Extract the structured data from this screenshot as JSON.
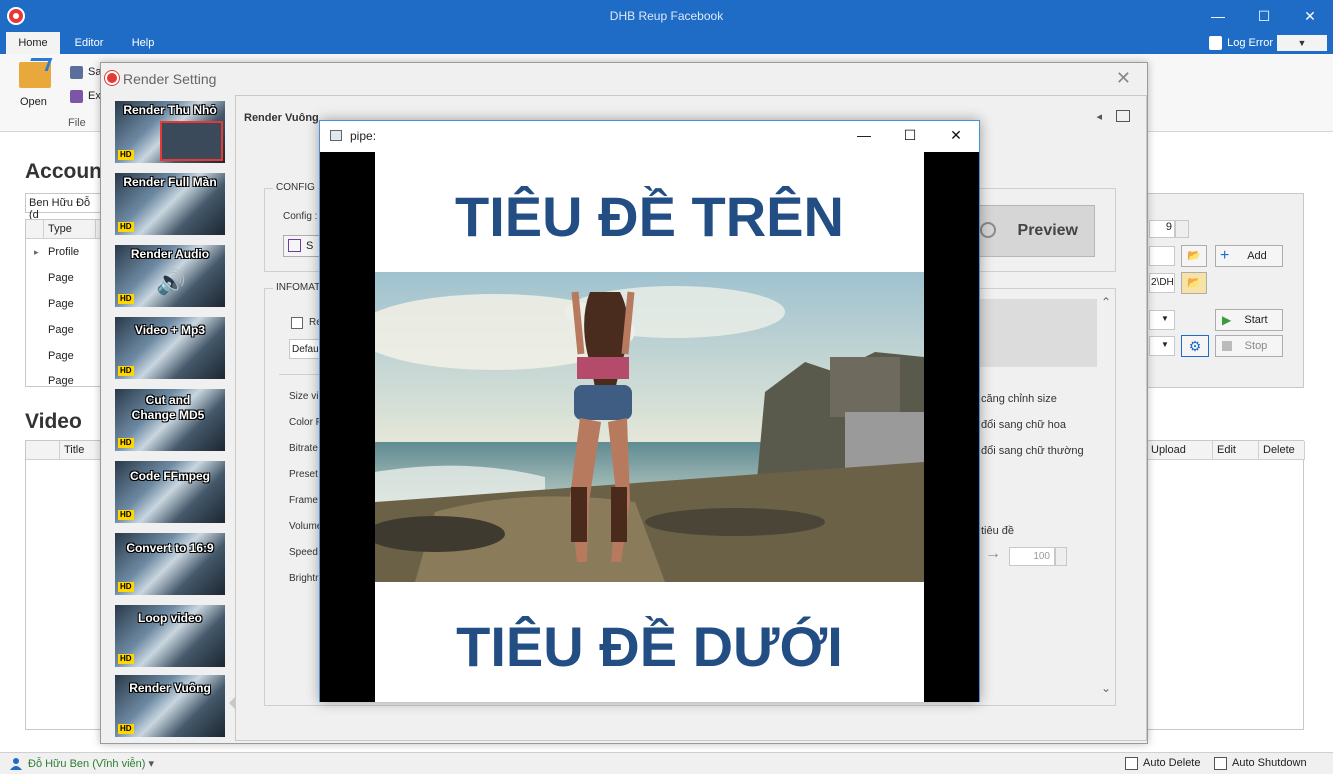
{
  "app": {
    "title": "DHB Reup Facebook"
  },
  "window_controls": {
    "minimize": "—",
    "maximize": "☐",
    "close": "✕"
  },
  "ribbon": {
    "tabs": [
      {
        "label": "Home"
      },
      {
        "label": "Editor"
      },
      {
        "label": "Help"
      }
    ],
    "log_error": "Log Error",
    "log_drop": "▼",
    "open_label": "Open",
    "save_label": "Sa",
    "export_label": "Ex",
    "file_group": "File"
  },
  "background": {
    "account_heading": "Accoun",
    "account_select": "Ben Hữu Đỗ (d",
    "account_headers": [
      "Type",
      "I"
    ],
    "account_rows": [
      "Profile",
      "Page",
      "Page",
      "Page",
      "Page",
      "Page"
    ],
    "row_marker": "▸",
    "video_heading": "Video",
    "video_headers": [
      "Title"
    ],
    "video_right_headers": [
      "Upload",
      "Edit",
      "Delete"
    ],
    "spin_value": "9",
    "path_value": "2\\DHE",
    "add_label": "Add",
    "start_label": "Start",
    "stop_label": "Stop"
  },
  "status_bar": {
    "user": "Đỗ Hữu Ben (Vĩnh viễn)",
    "user_drop": "▾",
    "auto_delete": "Auto Delete",
    "auto_shutdown": "Auto Shutdown"
  },
  "render_setting": {
    "title": "Render Setting",
    "close": "✕",
    "menu": [
      {
        "label": "Render Thu Nhỏ",
        "hd": "HD"
      },
      {
        "label": "Render Full Màn",
        "hd": "HD"
      },
      {
        "label": "Render Audio",
        "hd": "HD"
      },
      {
        "label": "Video + Mp3",
        "hd": "HD"
      },
      {
        "label": "Cut and Change MD5",
        "hd": "HD"
      },
      {
        "label": "Code FFmpeg",
        "hd": "HD"
      },
      {
        "label": "Convert to 16:9",
        "hd": "HD"
      },
      {
        "label": "Loop video",
        "hd": "HD"
      },
      {
        "label": "Render Vuông",
        "hd": "HD"
      }
    ],
    "panel_title": "Render Vuông",
    "panel_nav": "◂",
    "config_group": "CONFIG",
    "config_label": "Config :",
    "config_btn": "S",
    "info_group": "INFOMAT",
    "checkbox_label": "Re",
    "default_select": "Defau",
    "field_labels": [
      "Size vi",
      "Color F",
      "Bitrate",
      "Preset",
      "Frame",
      "Volume",
      "Speed",
      "Brightr"
    ],
    "preview_label": "Preview",
    "right_options": [
      "căng chỉnh size",
      "đổi sang chữ hoa",
      "đổi sang chữ thường"
    ],
    "title_option": "tiêu đề",
    "arrow": "→",
    "spin_value": "100",
    "scroll_up": "⌃",
    "scroll_down": "⌄"
  },
  "pipe_window": {
    "title": "pipe:",
    "top_text": "TIÊU ĐỀ TRÊN",
    "bottom_text": "TIÊU ĐỀ DƯỚI"
  },
  "colors": {
    "accent": "#1e6cc6",
    "title_text": "#234e84",
    "hd_badge": "#ffd600"
  }
}
